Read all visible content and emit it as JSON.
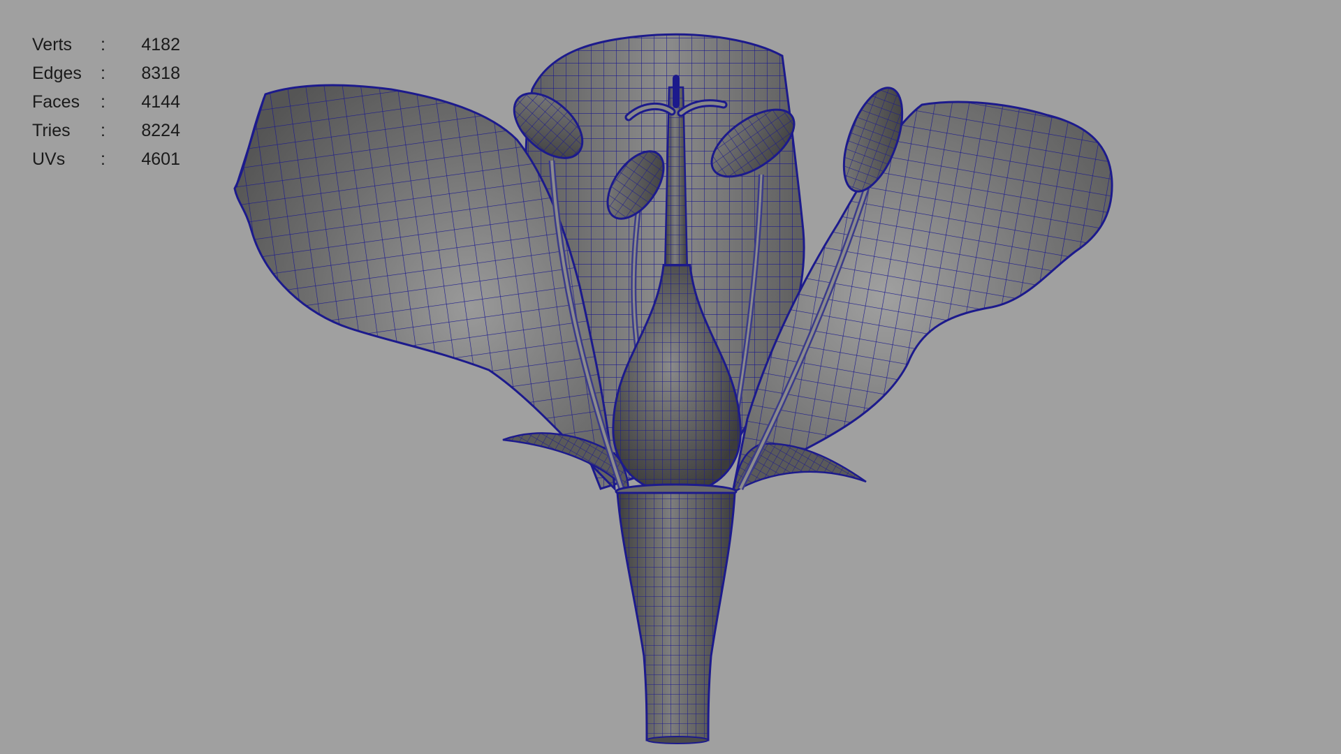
{
  "viewport": {
    "background": "#a0a0a0",
    "wire_color": "#1c1a8c",
    "shade_light": "#8a8a8a",
    "shade_dark": "#4a4a4a"
  },
  "hud": {
    "rows": [
      {
        "label": "Verts",
        "sep": ":",
        "value": "4182"
      },
      {
        "label": "Edges",
        "sep": ":",
        "value": "8318"
      },
      {
        "label": "Faces",
        "sep": ":",
        "value": "4144"
      },
      {
        "label": "Tries",
        "sep": ":",
        "value": "8224"
      },
      {
        "label": "UVs",
        "sep": ":",
        "value": "4601"
      }
    ]
  },
  "scene": {
    "object": "flower-wireframe-mesh"
  }
}
